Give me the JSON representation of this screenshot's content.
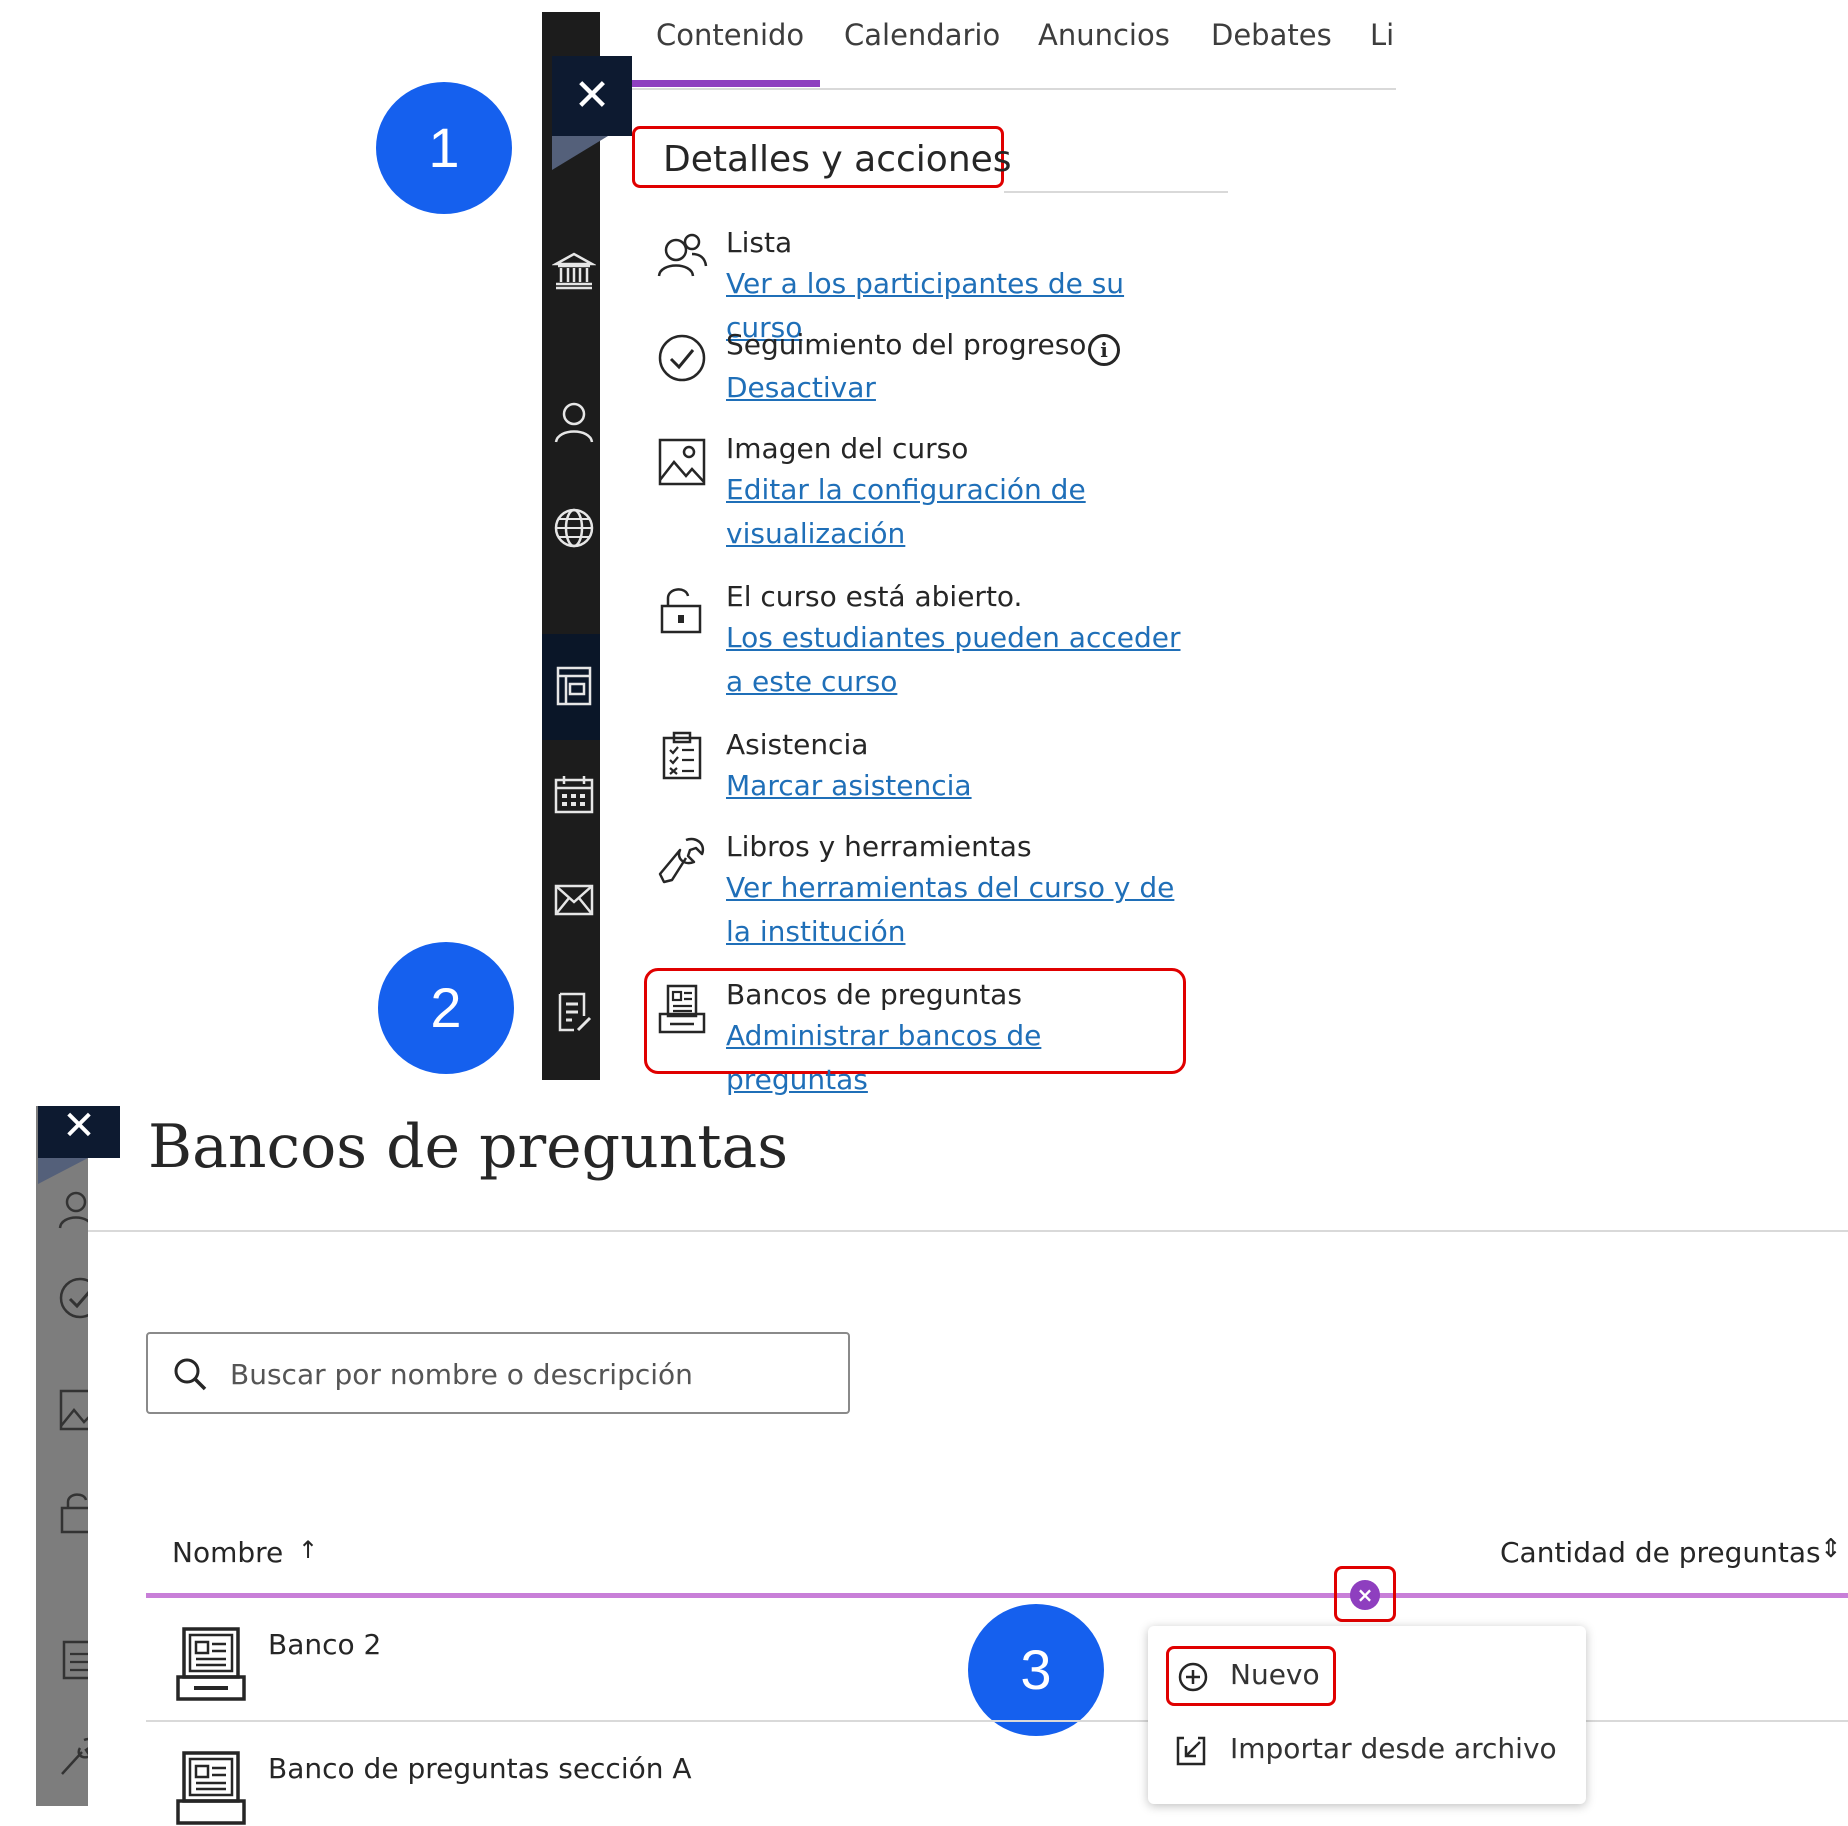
{
  "top": {
    "close_glyph": "✕",
    "tabs": [
      "Contenido",
      "Calendario",
      "Anuncios",
      "Debates",
      "Li"
    ],
    "details_heading": "Detalles y acciones",
    "items": [
      {
        "title": "Lista",
        "link": "Ver a los participantes de su curso",
        "icon": "roster-icon"
      },
      {
        "title": "Seguimiento del progreso",
        "link": "Desactivar",
        "icon": "check-circle-icon"
      },
      {
        "title": "Imagen del curso",
        "link": "Editar la configuración de visualización",
        "icon": "image-icon"
      },
      {
        "title": "El curso está abierto.",
        "link": "Los estudiantes pueden acceder a este curso",
        "icon": "unlock-icon"
      },
      {
        "title": "Asistencia",
        "link": "Marcar asistencia",
        "icon": "attendance-icon"
      },
      {
        "title": "Libros y herramientas",
        "link": "Ver herramientas del curso y de la institución",
        "icon": "wrench-icon"
      },
      {
        "title": "Bancos de preguntas",
        "link": "Administrar bancos de preguntas",
        "icon": "question-bank-icon"
      }
    ],
    "info_glyph": "i"
  },
  "badges": [
    "1",
    "2",
    "3"
  ],
  "bottom": {
    "close_glyph": "✕",
    "title": "Bancos de preguntas",
    "search": {
      "placeholder": "Buscar por nombre o descripción",
      "value": ""
    },
    "columns": {
      "name": "Nombre",
      "name_sort": "↑",
      "count": "Cantidad de preguntas",
      "count_sort": "⇕"
    },
    "add_glyph": "×",
    "banks": [
      {
        "name": "Banco 2"
      },
      {
        "name": "Banco de preguntas sección A"
      }
    ],
    "menu": [
      {
        "label": "Nuevo",
        "icon": "plus-circle-icon"
      },
      {
        "label": "Importar desde archivo",
        "icon": "import-icon"
      }
    ]
  },
  "colors": {
    "accent": "#8e3fbf",
    "link": "#1f6fb8",
    "highlight": "#e00000",
    "badge": "#1560ee"
  }
}
